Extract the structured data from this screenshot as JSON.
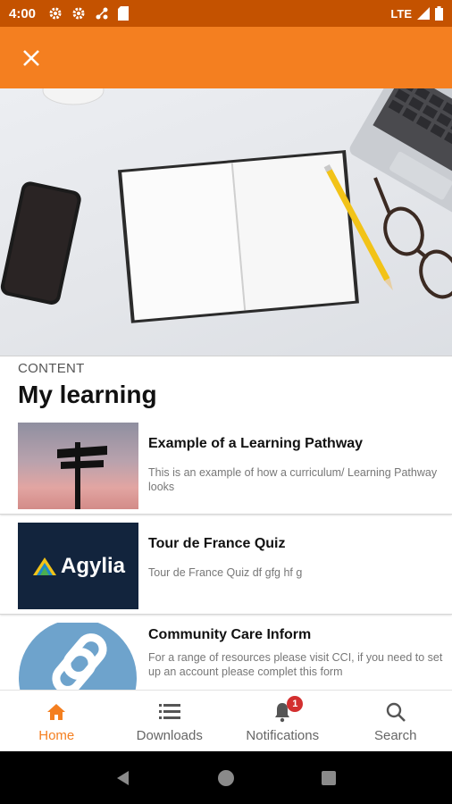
{
  "status_bar": {
    "time": "4:00",
    "network": "LTE"
  },
  "app_bar": {
    "close_icon": "close-icon"
  },
  "content": {
    "section_label": "CONTENT",
    "title": "My learning",
    "items": [
      {
        "title": "Example of a Learning Pathway",
        "description": "This is an example of how a curriculum/ Learning Pathway looks"
      },
      {
        "title": "Tour de France Quiz",
        "description": "Tour de France Quiz df gfg hf g",
        "thumb_text": "Agylia"
      },
      {
        "title": "Community Care Inform",
        "description": "For a range of resources please visit CCI, if you need to set up an account please complet this form"
      }
    ]
  },
  "bottom_nav": {
    "items": [
      {
        "label": "Home",
        "icon": "home-icon",
        "active": true
      },
      {
        "label": "Downloads",
        "icon": "list-icon"
      },
      {
        "label": "Notifications",
        "icon": "bell-icon",
        "badge": "1"
      },
      {
        "label": "Search",
        "icon": "search-icon"
      }
    ]
  },
  "colors": {
    "accent": "#f47f20",
    "status_bar": "#c45200",
    "badge": "#d32f2f"
  }
}
